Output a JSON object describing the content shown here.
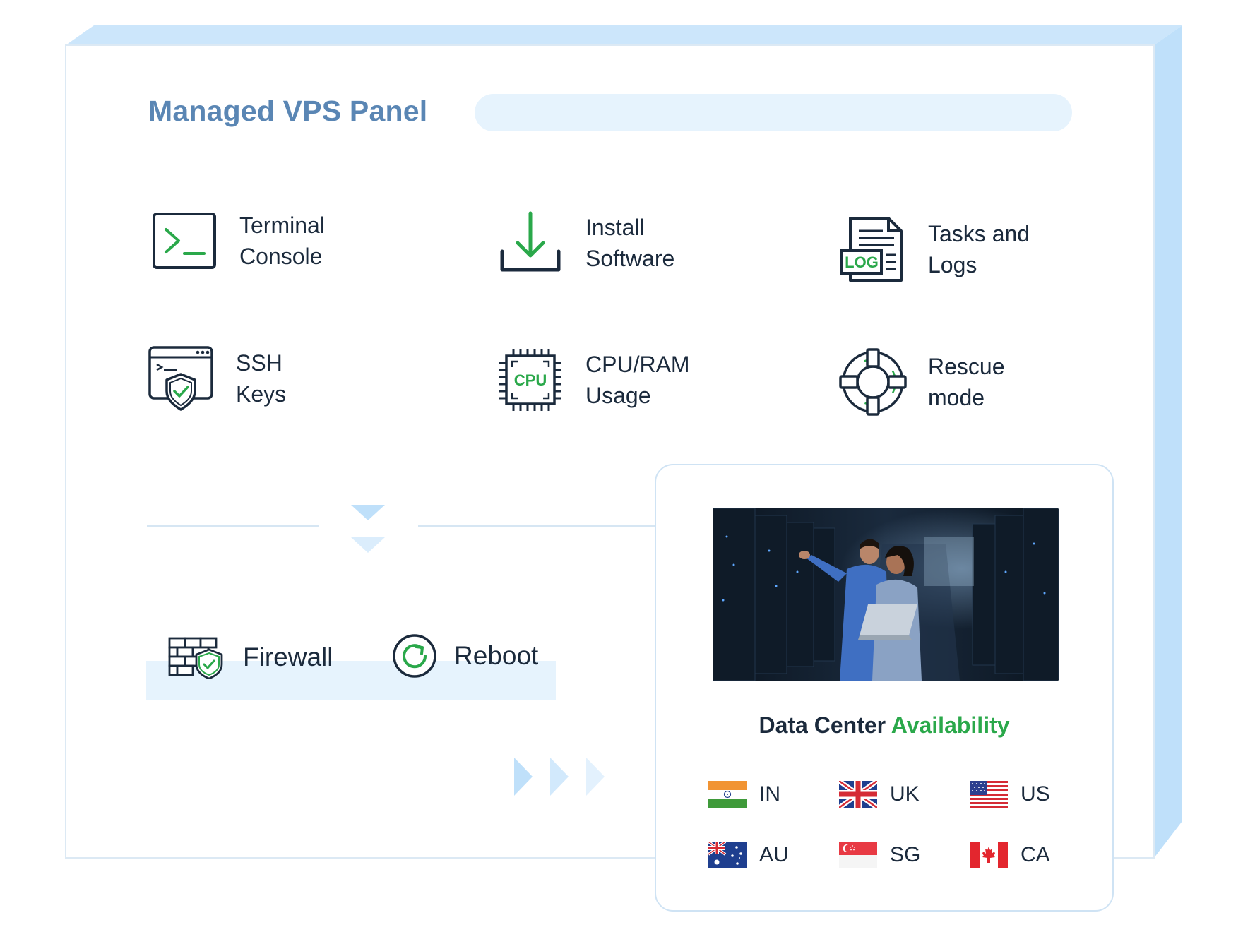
{
  "panel": {
    "title": "Managed VPS Panel"
  },
  "features": [
    {
      "label": "Terminal\nConsole",
      "icon": "terminal-icon"
    },
    {
      "label": "Install\nSoftware",
      "icon": "download-icon"
    },
    {
      "label": "Tasks and\nLogs",
      "icon": "log-file-icon"
    },
    {
      "label": "SSH\nKeys",
      "icon": "ssh-shield-icon"
    },
    {
      "label": "CPU/RAM\nUsage",
      "icon": "cpu-chip-icon"
    },
    {
      "label": "Rescue\nmode",
      "icon": "lifebuoy-icon"
    }
  ],
  "quick_actions": [
    {
      "label": "Firewall",
      "icon": "firewall-icon"
    },
    {
      "label": "Reboot",
      "icon": "reboot-icon"
    }
  ],
  "data_center": {
    "title_prefix": "Data Center ",
    "title_accent": "Availability",
    "photo_icon": "server-room-photo",
    "locations": [
      {
        "code": "IN",
        "flag": "india-flag-icon"
      },
      {
        "code": "UK",
        "flag": "uk-flag-icon"
      },
      {
        "code": "US",
        "flag": "us-flag-icon"
      },
      {
        "code": "AU",
        "flag": "australia-flag-icon"
      },
      {
        "code": "SG",
        "flag": "singapore-flag-icon"
      },
      {
        "code": "CA",
        "flag": "canada-flag-icon"
      }
    ]
  },
  "colors": {
    "title": "#5a86b4",
    "accent_green": "#2aa84a",
    "navy": "#1b2a3c",
    "light_blue": "#e6f3fd",
    "frame_blue": "#cce6fb"
  }
}
